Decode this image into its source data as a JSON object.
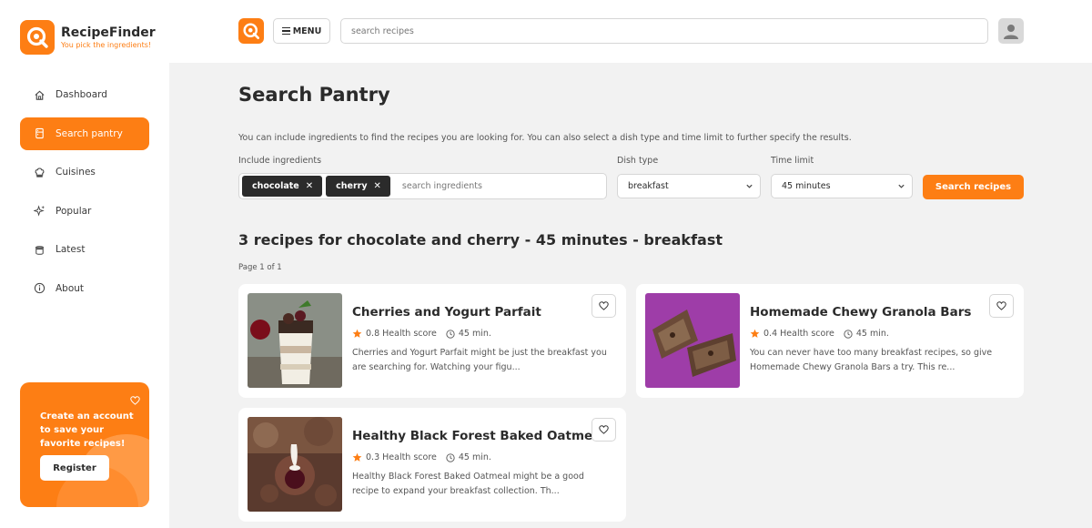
{
  "brand": {
    "name": "RecipeFinder",
    "tagline": "You pick the ingredients!"
  },
  "sidebar": {
    "items": [
      {
        "label": "Dashboard",
        "icon": "home-icon",
        "active": false
      },
      {
        "label": "Search pantry",
        "icon": "pantry-icon",
        "active": true
      },
      {
        "label": "Cuisines",
        "icon": "chef-hat-icon",
        "active": false
      },
      {
        "label": "Popular",
        "icon": "sparkle-icon",
        "active": false
      },
      {
        "label": "Latest",
        "icon": "cooking-pot-icon",
        "active": false
      },
      {
        "label": "About",
        "icon": "info-icon",
        "active": false
      }
    ],
    "promo": {
      "text": "Create an account to save your favorite recipes!",
      "button": "Register"
    }
  },
  "topbar": {
    "menu_label": "MENU",
    "search_placeholder": "search recipes"
  },
  "main": {
    "title": "Search Pantry",
    "intro": "You can include ingredients to find the recipes you are looking for. You can also select a dish type and time limit to further specify the results.",
    "ingredients_label": "Include ingredients",
    "chips": [
      "chocolate",
      "cherry"
    ],
    "ingredients_placeholder": "search ingredients",
    "dish_type_label": "Dish type",
    "dish_type_value": "breakfast",
    "time_limit_label": "Time limit",
    "time_limit_value": "45 minutes",
    "search_button": "Search recipes",
    "result_heading": "3 recipes for chocolate and cherry - 45 minutes - breakfast",
    "page_info": "Page 1 of 1"
  },
  "recipes": [
    {
      "title": "Cherries and Yogurt Parfait",
      "health": "0.8 Health score",
      "time": "45 min.",
      "description": "Cherries and Yogurt Parfait might be just the breakfast you are searching for. Watching your figu..."
    },
    {
      "title": "Homemade Chewy Granola Bars",
      "health": "0.4 Health score",
      "time": "45 min.",
      "description": "You can never have too many breakfast recipes, so give Homemade Chewy Granola Bars a try. This re..."
    },
    {
      "title": "Healthy Black Forest Baked Oatmeal",
      "health": "0.3 Health score",
      "time": "45 min.",
      "description": "Healthy Black Forest Baked Oatmeal might be a good recipe to expand your breakfast collection. Th..."
    }
  ],
  "colors": {
    "accent": "#fd7e14",
    "dark": "#2b2b2b",
    "background": "#f2f2f2"
  }
}
